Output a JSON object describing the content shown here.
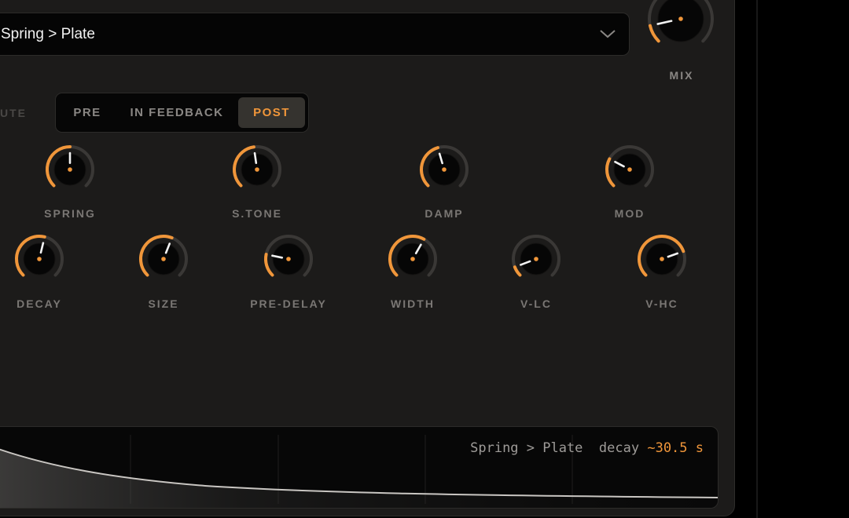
{
  "preset": {
    "name": "Spring > Plate",
    "dropdown_icon": "chevron-down-icon"
  },
  "mix": {
    "label": "MIX",
    "value": 0.12
  },
  "route": {
    "label": "UTE",
    "options": [
      "PRE",
      "IN FEEDBACK",
      "POST"
    ],
    "selected": "POST"
  },
  "knobs": [
    {
      "id": "spring",
      "label": "SPRING",
      "value": 0.5
    },
    {
      "id": "stone",
      "label": "S.TONE",
      "value": 0.47
    },
    {
      "id": "damp",
      "label": "DAMP",
      "value": 0.44
    },
    {
      "id": "mod",
      "label": "MOD",
      "value": 0.27
    },
    {
      "id": "decay",
      "label": "DECAY",
      "value": 0.55
    },
    {
      "id": "size",
      "label": "SIZE",
      "value": 0.58
    },
    {
      "id": "predelay",
      "label": "PRE-DELAY",
      "value": 0.21
    },
    {
      "id": "width",
      "label": "WIDTH",
      "value": 0.61
    },
    {
      "id": "vlc",
      "label": "V-LC",
      "value": 0.09
    },
    {
      "id": "vhc",
      "label": "V-HC",
      "value": 0.76
    }
  ],
  "readout": {
    "preset": "Spring > Plate",
    "param": "decay",
    "value": "~30.5 s"
  },
  "colors": {
    "accent": "#f0963a",
    "panel": "#1c1b1a",
    "track": "#3a3836",
    "text": "#7a7774"
  }
}
